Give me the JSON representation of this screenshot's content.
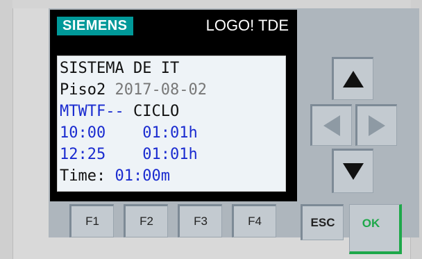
{
  "brand": {
    "logo_text": "SIEMENS",
    "model": "LOGO! TDE",
    "logo_color": "#009999"
  },
  "display": {
    "lines": [
      {
        "text": "SISTEMA DE IT"
      },
      {
        "prefix": "Piso2 ",
        "date": "2017-08-02"
      },
      {
        "days": "MTWTF--",
        "label": " CICLO"
      },
      {
        "time": "10:00",
        "duration": "01:01h"
      },
      {
        "time": "12:25",
        "duration": "01:01h"
      },
      {
        "prefix": "Time: ",
        "value": "01:00m"
      }
    ],
    "background": "#eef3f7",
    "text_color": "#111111",
    "value_color": "#1a2bd0"
  },
  "keys": {
    "function": [
      "F1",
      "F2",
      "F3",
      "F4"
    ],
    "esc": "ESC",
    "ok": "OK",
    "ok_color": "#1ea84a",
    "cursor": {
      "up": "up-arrow-icon",
      "down": "down-arrow-icon",
      "left": "left-arrow-icon",
      "right": "right-arrow-icon"
    }
  }
}
